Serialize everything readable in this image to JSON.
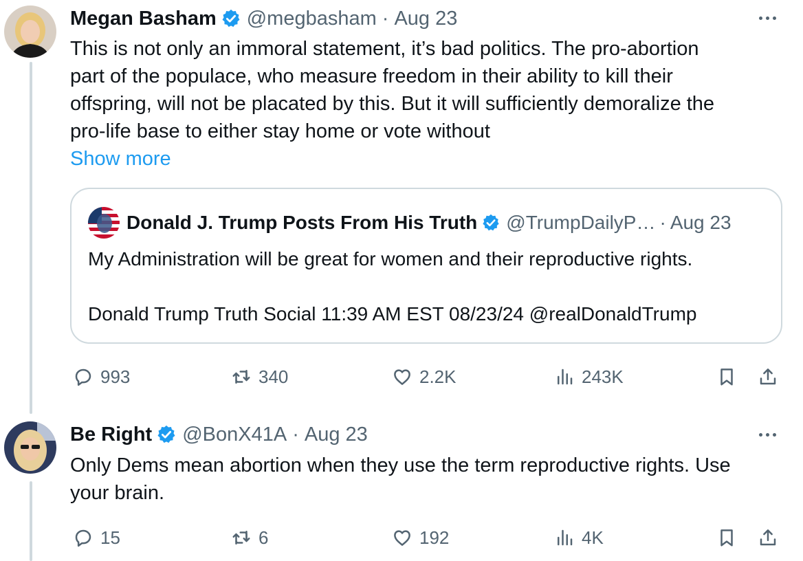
{
  "posts": [
    {
      "name": "Megan Basham",
      "handle": "@megbasham",
      "separator": "·",
      "date": "Aug 23",
      "text_lines": [
        "This is not only an immoral statement, it’s bad politics. The pro-abortion",
        "part of the populace, who measure freedom in their ability to kill their",
        "offspring, will not be placated by this. But it will sufficiently demoralize the",
        "pro-life base to either stay home or vote without"
      ],
      "show_more": "Show more",
      "quote": {
        "name": "Donald J. Trump Posts From His Truth",
        "handle": "@TrumpDailyP…",
        "separator": "·",
        "date": "Aug 23",
        "line1": "My Administration will be great for women and their reproductive rights.",
        "line2": "Donald Trump Truth Social 11:39 AM EST 08/23/24 @realDonaldTrump"
      },
      "replies": "993",
      "reposts": "340",
      "likes": "2.2K",
      "views": "243K"
    },
    {
      "name": "Be Right",
      "handle": "@BonX41A",
      "separator": "·",
      "date": "Aug 23",
      "text_lines": [
        "Only Dems mean abortion when they use the term reproductive rights. Use",
        "your brain."
      ],
      "replies": "15",
      "reposts": "6",
      "likes": "192",
      "views": "4K"
    }
  ],
  "colors": {
    "text": "#0f1419",
    "secondary": "#536471",
    "link": "#1d9bf0",
    "verified": "#1d9bf0",
    "border": "#cfd9de"
  },
  "icons": [
    "verified-badge-icon",
    "more-icon",
    "reply-icon",
    "repost-icon",
    "like-icon",
    "views-icon",
    "bookmark-icon",
    "share-icon"
  ]
}
